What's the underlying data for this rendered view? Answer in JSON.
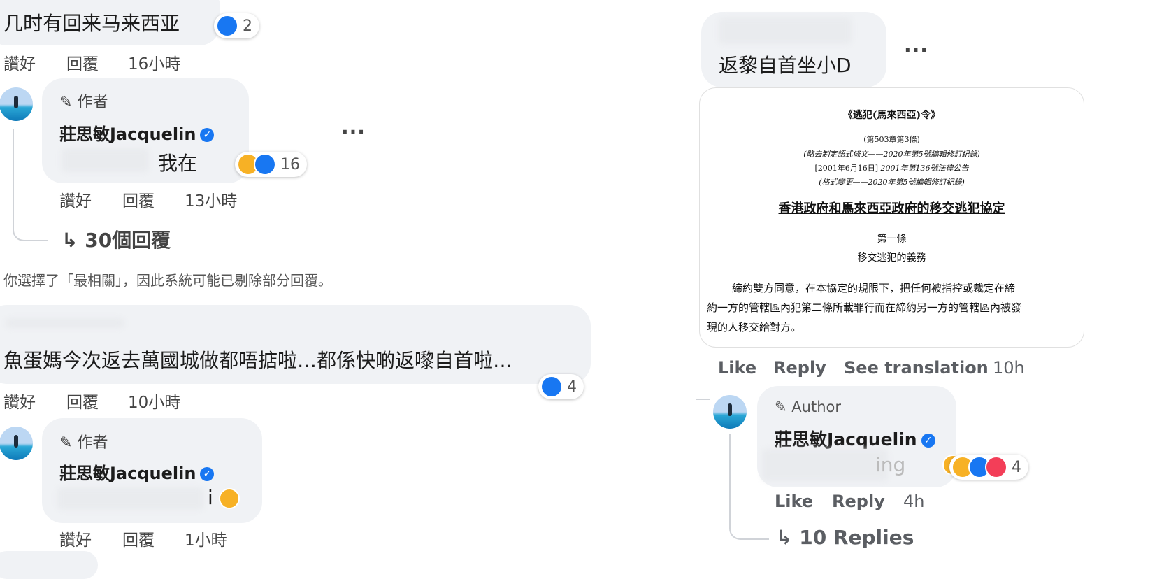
{
  "left": {
    "c1": {
      "text": "几时有回来马来西亚",
      "reactions": 2,
      "like": "讚好",
      "reply": "回覆",
      "time": "16小時"
    },
    "author_label": "作者",
    "author_name": "莊思敏Jacquelin",
    "c2": {
      "text": "我在",
      "reactions": 16,
      "like": "讚好",
      "reply": "回覆",
      "time": "13小時"
    },
    "replies_link": "30個回覆",
    "notice": "你選擇了「最相關」，因此系統可能已剔除部分回覆。",
    "c3": {
      "text": "魚蛋媽今次返去萬國城做都唔掂啦…都係快啲返嚟自首啦…",
      "reactions": 4,
      "like": "讚好",
      "reply": "回覆",
      "time": "10小時"
    },
    "c4": {
      "text": "i",
      "like": "讚好",
      "reply": "回覆",
      "time": "1小時"
    }
  },
  "right": {
    "c1": {
      "text": "返黎自首坐小D"
    },
    "doc": {
      "title": "《逃犯(馬來西亞)令》",
      "chapter": "(第503章第3條)",
      "line1": "(略去制定語式條文——2020年第5號編輯修訂紀錄)",
      "line2a": "[2001年6月16日]",
      "line2b": "2001年第136號法律公告",
      "line3": "(格式變更——2020年第5號編輯修訂紀錄)",
      "heading": "香港政府和馬來西亞政府的移交逃犯協定",
      "article": "第一條",
      "article_title": "移交逃犯的義務",
      "para1": "締約雙方同意，在本協定的規限下，把任何被指控或裁定在締",
      "para2": "約一方的管轄區內犯第二條所載罪行而在締約另一方的管轄區內被發",
      "para3": "現的人移交給對方。"
    },
    "actions": {
      "like": "Like",
      "reply": "Reply",
      "translate": "See translation",
      "time": "10h"
    },
    "author_label": "Author",
    "author_name": "莊思敏Jacquelin",
    "c2": {
      "text": "ing",
      "reactions": 4,
      "like": "Like",
      "reply": "Reply",
      "time": "4h"
    },
    "replies_link": "10 Replies"
  },
  "colors": {
    "like_blue": "#1877f2",
    "bubble": "#f0f2f5"
  }
}
